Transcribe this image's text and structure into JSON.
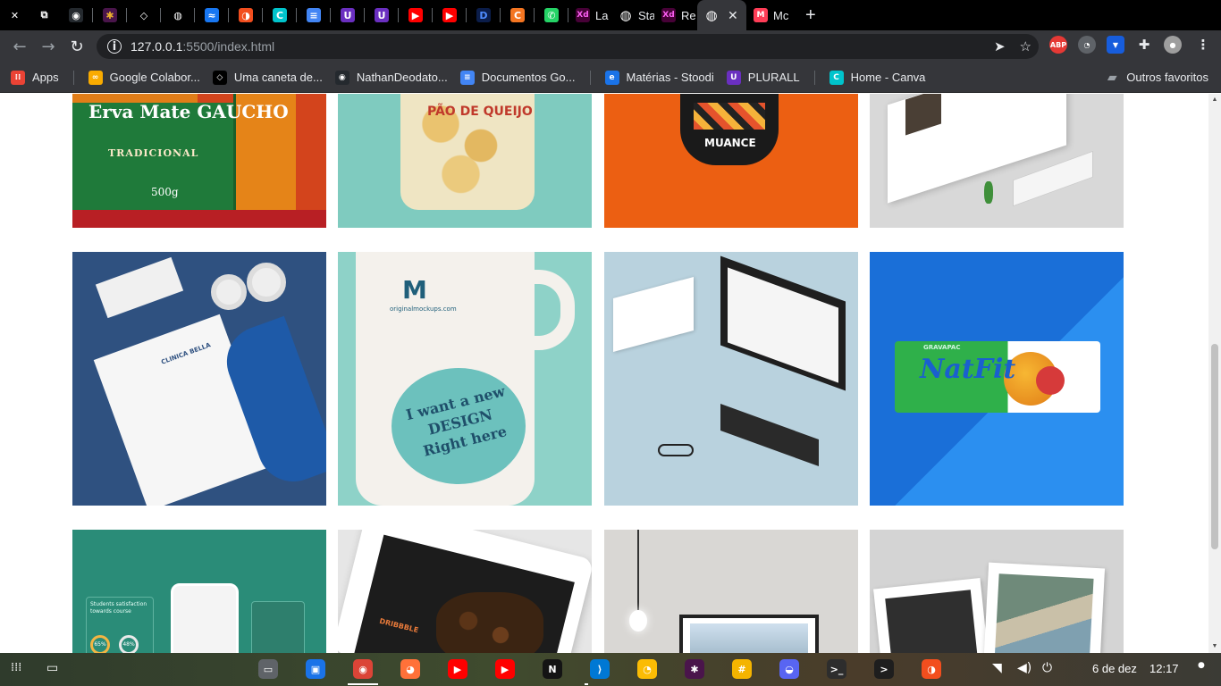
{
  "browser": {
    "tabs": [
      {
        "icon": "close-icon",
        "glyph": "✕",
        "color": "#000000",
        "fg": "#ffffff"
      },
      {
        "icon": "screen-icon",
        "glyph": "⧉",
        "color": "#000000",
        "fg": "#ffffff"
      },
      {
        "icon": "github-icon",
        "glyph": "◉",
        "color": "#24292e",
        "fg": "#ffffff"
      },
      {
        "icon": "slack-icon",
        "glyph": "✱",
        "color": "#4a154b",
        "fg": "#ecb22e"
      },
      {
        "icon": "codesandbox-icon",
        "glyph": "◇",
        "color": "#000000",
        "fg": "#ffffff"
      },
      {
        "icon": "globe-icon",
        "glyph": "◍",
        "color": "#000000",
        "fg": "#ffffff"
      },
      {
        "icon": "messenger-icon",
        "glyph": "≈",
        "color": "#1877f2",
        "fg": "#ffffff"
      },
      {
        "icon": "figma-icon",
        "glyph": "◑",
        "color": "#f24e1e",
        "fg": "#ffffff"
      },
      {
        "icon": "canva-icon",
        "glyph": "C",
        "color": "#00c4cc",
        "fg": "#ffffff"
      },
      {
        "icon": "google-docs-icon",
        "glyph": "≡",
        "color": "#4285f4",
        "fg": "#ffffff"
      },
      {
        "icon": "plurall-icon",
        "glyph": "U",
        "color": "#6a2fc0",
        "fg": "#ffffff"
      },
      {
        "icon": "plurall-icon",
        "glyph": "U",
        "color": "#6a2fc0",
        "fg": "#ffffff"
      },
      {
        "icon": "youtube-music-icon",
        "glyph": "▶",
        "color": "#ff0000",
        "fg": "#ffffff"
      },
      {
        "icon": "youtube-icon",
        "glyph": "▶",
        "color": "#ff0000",
        "fg": "#ffffff"
      },
      {
        "icon": "disney-icon",
        "glyph": "D",
        "color": "#0b1d4a",
        "fg": "#4f8cff"
      },
      {
        "icon": "crunchyroll-icon",
        "glyph": "C",
        "color": "#f47521",
        "fg": "#ffffff"
      },
      {
        "icon": "whatsapp-icon",
        "glyph": "✆",
        "color": "#25d366",
        "fg": "#ffffff"
      }
    ],
    "named_tabs": [
      {
        "icon": "adobe-xd-icon",
        "glyph": "Xd",
        "title": "La"
      },
      {
        "icon": "globe-icon",
        "glyph": "◍",
        "title": "Sta"
      },
      {
        "icon": "adobe-xd-icon",
        "glyph": "Xd",
        "title": "Re"
      },
      {
        "icon": "globe-icon",
        "glyph": "◍",
        "title": "",
        "active": true
      },
      {
        "icon": "monday-icon",
        "glyph": "M",
        "title": "Mc"
      }
    ],
    "url_host": "127.0.0.1",
    "url_path": ":5500/index.html",
    "bookmarks": [
      {
        "label": "Apps",
        "icon": "apps-grid-icon",
        "glyph": "⁞⁞",
        "color": "#ea4335"
      },
      {
        "label": "Google Colabor...",
        "icon": "colab-icon",
        "glyph": "∞",
        "color": "#f9ab00"
      },
      {
        "label": "Uma caneta de...",
        "icon": "codepen-icon",
        "glyph": "◇",
        "color": "#000000"
      },
      {
        "label": "NathanDeodato...",
        "icon": "github-icon",
        "glyph": "◉",
        "color": "#24292e"
      },
      {
        "label": "Documentos Go...",
        "icon": "google-docs-icon",
        "glyph": "≡",
        "color": "#4285f4"
      },
      {
        "label": "Matérias - Stoodi",
        "icon": "stoodi-icon",
        "glyph": "e",
        "color": "#1a73e8"
      },
      {
        "label": "PLURALL",
        "icon": "plurall-icon",
        "glyph": "U",
        "color": "#6a2fc0"
      },
      {
        "label": "Home - Canva",
        "icon": "canva-icon",
        "glyph": "C",
        "color": "#00c4cc"
      }
    ],
    "other_bookmarks": "Outros favoritos"
  },
  "gallery": {
    "rows": [
      [
        {
          "name": "erva-mate-gaucho-mockup",
          "bg": "#d3441c",
          "caption": "Erva Mate GAUCHO",
          "sub": "TRADICIONAL",
          "weight": "500g"
        },
        {
          "name": "pao-de-queijo-mockup",
          "bg": "#7fcbbf",
          "caption": "PÃO DE QUEIJO"
        },
        {
          "name": "muance-coffee-mockup",
          "bg": "#ec5f12",
          "caption": "MUANCE"
        },
        {
          "name": "website-devices-mockup",
          "bg": "#d8d8d8"
        }
      ],
      [
        {
          "name": "stationery-branding-mockup",
          "bg": "#2f5180",
          "caption": "CLINICA BELLA"
        },
        {
          "name": "mug-design-mockup",
          "bg": "#8ed2c8",
          "caption": "I want a new DESIGN Right here",
          "brand": "originalmockups.com"
        },
        {
          "name": "isometric-devices-mockup",
          "bg": "#b9d2de"
        },
        {
          "name": "natfit-bar-mockup",
          "bg": "#1f7fe0",
          "caption": "NatFit",
          "brand": "GRAVAPAC"
        }
      ],
      [
        {
          "name": "mobile-app-mockup",
          "bg": "#2a8c78",
          "caption": "Students satisfaction towards course",
          "stat1": "65%",
          "stat2": "48%"
        },
        {
          "name": "ipad-coffee-mockup",
          "bg": "#e6e6e6",
          "caption": "DRIBBBLE"
        },
        {
          "name": "lamp-frame-mockup",
          "bg": "#d9d7d4"
        },
        {
          "name": "photo-prints-mockup",
          "bg": "#d4d4d4"
        }
      ]
    ]
  },
  "shelf": {
    "apps": [
      {
        "icon": "files-icon",
        "glyph": "▭",
        "color": "#5f6368"
      },
      {
        "icon": "store-icon",
        "glyph": "▣",
        "color": "#1a73e8"
      },
      {
        "icon": "chrome-icon",
        "glyph": "◉",
        "color": "#db4437"
      },
      {
        "icon": "firefox-icon",
        "glyph": "◕",
        "color": "#ff7139"
      },
      {
        "icon": "youtube-icon",
        "glyph": "▶",
        "color": "#ff0000"
      },
      {
        "icon": "youtube-music-icon",
        "glyph": "▶",
        "color": "#ff0000"
      },
      {
        "icon": "netflix-icon",
        "glyph": "N",
        "color": "#141414"
      },
      {
        "icon": "vscode-icon",
        "glyph": "⟩",
        "color": "#0078d4"
      },
      {
        "icon": "keep-icon",
        "glyph": "◔",
        "color": "#fbbc04"
      },
      {
        "icon": "slack-icon",
        "glyph": "✱",
        "color": "#4a154b"
      },
      {
        "icon": "hashtag-icon",
        "glyph": "#",
        "color": "#f4b400"
      },
      {
        "icon": "discord-icon",
        "glyph": "◒",
        "color": "#5865f2"
      },
      {
        "icon": "terminal-icon",
        "glyph": ">_",
        "color": "#2d2d2d"
      },
      {
        "icon": "terminal-dark-icon",
        "glyph": ">",
        "color": "#1e1e1e"
      },
      {
        "icon": "figma-icon",
        "glyph": "◑",
        "color": "#f24e1e"
      }
    ],
    "date": "6 de dez",
    "time": "12:17"
  }
}
